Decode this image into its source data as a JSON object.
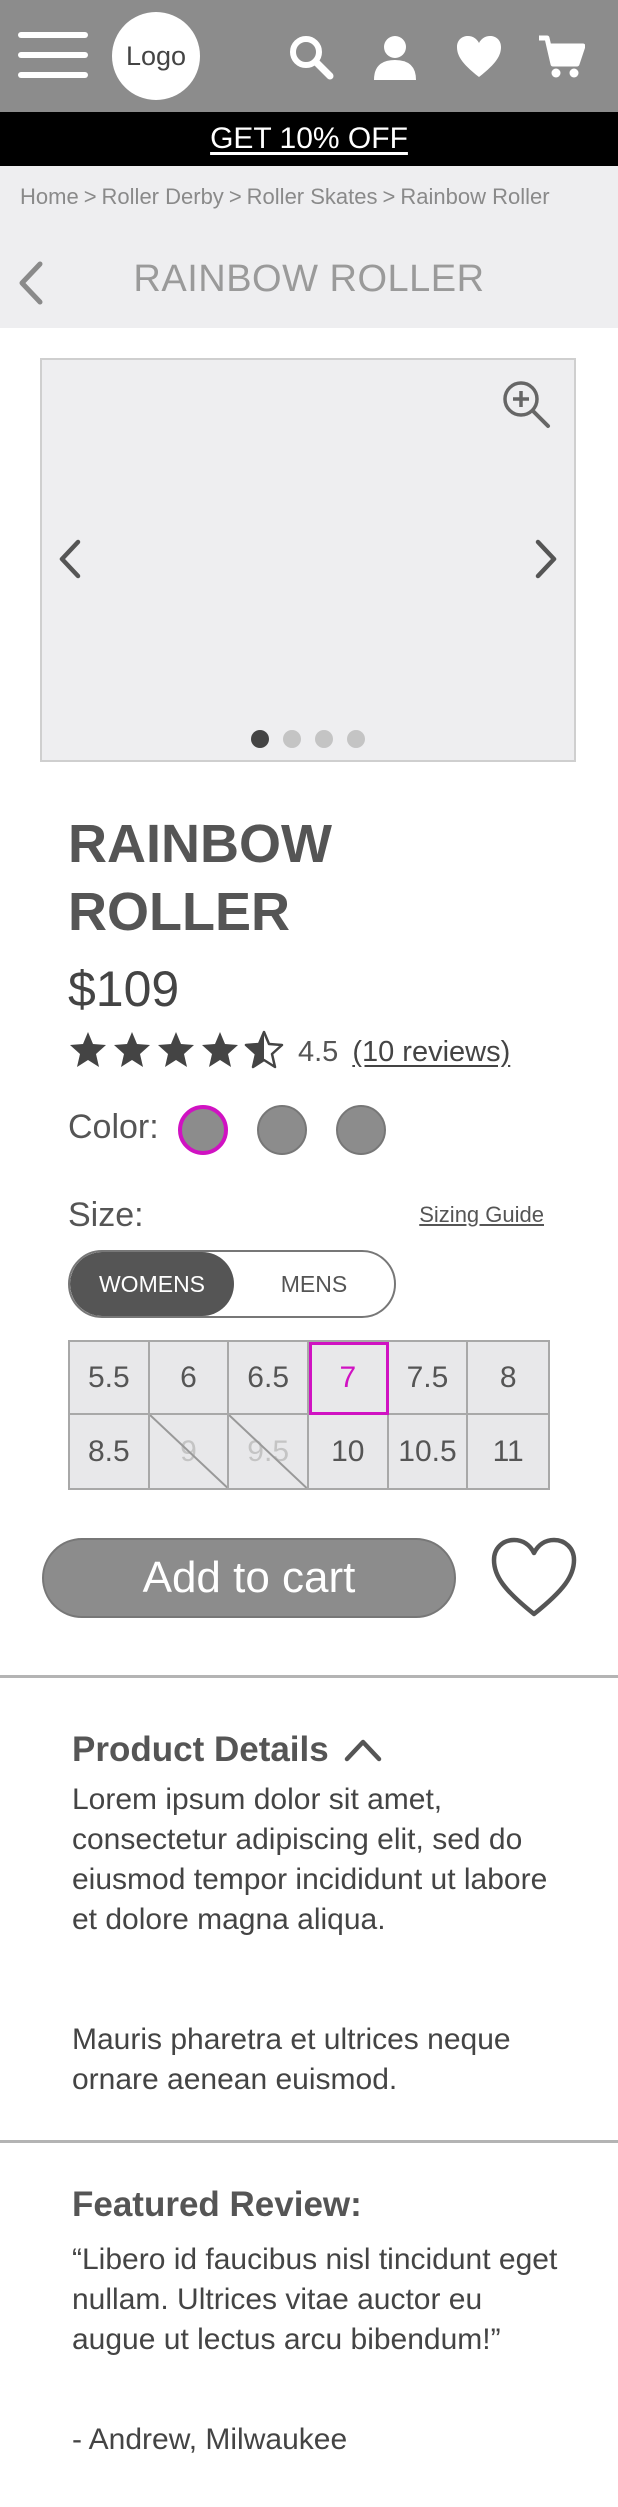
{
  "header": {
    "logo_text": "Logo",
    "icons": [
      "menu-icon",
      "search-icon",
      "account-icon",
      "heart-icon",
      "cart-icon"
    ]
  },
  "promo": {
    "text": "GET 10% OFF"
  },
  "breadcrumb": {
    "items": [
      "Home",
      "Roller Derby",
      "Roller Skates",
      "Rainbow Roller"
    ],
    "separator": ">"
  },
  "page": {
    "title": "RAINBOW ROLLER"
  },
  "gallery": {
    "slide_count": 4,
    "active_slide": 1
  },
  "product": {
    "title": "RAINBOW ROLLER",
    "price": "$109",
    "rating": 4.5,
    "rating_text": "4.5",
    "reviews_text": "(10 reviews)",
    "color_label": "Color:",
    "colors": [
      "#8c8c8c",
      "#8c8c8c",
      "#8c8c8c"
    ],
    "selected_color_index": 0,
    "size_label": "Size:",
    "sizing_guide": "Sizing Guide",
    "genders": [
      "WOMENS",
      "MENS"
    ],
    "selected_gender": "WOMENS",
    "sizes": [
      {
        "label": "5.5",
        "available": true
      },
      {
        "label": "6",
        "available": true
      },
      {
        "label": "6.5",
        "available": true
      },
      {
        "label": "7",
        "available": true,
        "selected": true
      },
      {
        "label": "7.5",
        "available": true
      },
      {
        "label": "8",
        "available": true
      },
      {
        "label": "8.5",
        "available": true
      },
      {
        "label": "9",
        "available": false
      },
      {
        "label": "9.5",
        "available": false
      },
      {
        "label": "10",
        "available": true
      },
      {
        "label": "10.5",
        "available": true
      },
      {
        "label": "11",
        "available": true
      }
    ],
    "add_to_cart": "Add to cart"
  },
  "details": {
    "title": "Product Details",
    "paragraph1": "Lorem ipsum dolor sit amet, consectetur adipiscing elit, sed do eiusmod tempor incididunt ut labore et dolore magna aliqua.",
    "paragraph2": "Mauris pharetra et ultrices neque ornare aenean euismod."
  },
  "review": {
    "title": "Featured Review:",
    "quote": "“Libero id faucibus nisl tincidunt eget nullam. Ultrices vitae auctor eu augue ut lectus arcu bibendum!”",
    "author": "- Andrew, Milwaukee"
  },
  "colors": {
    "header_bg": "#8c8c8c",
    "promo_bg": "#000000",
    "accent": "#d012c2",
    "panel_bg": "#eeeef0"
  }
}
